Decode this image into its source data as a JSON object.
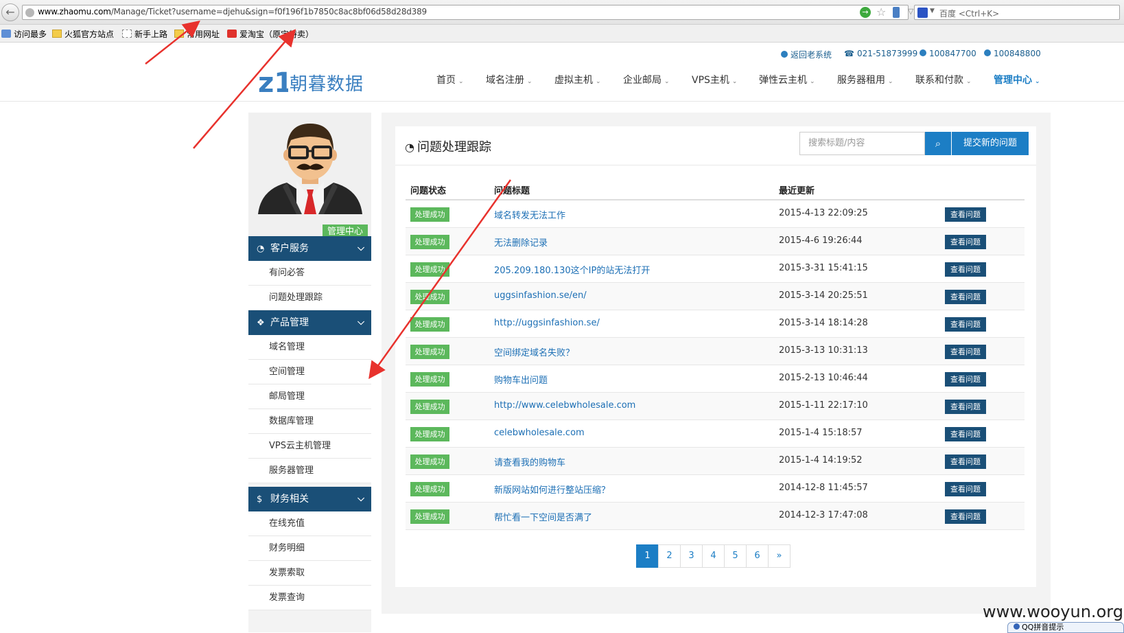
{
  "browser": {
    "url_host": "www.zhaomu.com",
    "url_path": "/Manage/Ticket?username=djehu&sign=f0f196f1b7850c8ac8bf06d58d28d389",
    "search_placeholder": "百度 <Ctrl+K>",
    "bookmarks": [
      "访问最多",
      "火狐官方站点",
      "新手上路",
      "常用网址",
      "爱淘宝（原",
      "宝特卖）"
    ]
  },
  "header": {
    "top_links": [
      "返回老系统",
      "021-51873999",
      "100847700",
      "100848800"
    ],
    "logo_text": "朝暮数据",
    "logo_mark": "z1",
    "nav": [
      "首页",
      "域名注册",
      "虚拟主机",
      "企业邮局",
      "VPS主机",
      "弹性云主机",
      "服务器租用",
      "联系和付款",
      "管理中心"
    ],
    "caret": "⌄"
  },
  "sidebar": {
    "badge": "管理中心",
    "sections": [
      {
        "title": "客户服务",
        "items": [
          "有问必答",
          "问题处理跟踪"
        ]
      },
      {
        "title": "产品管理",
        "items": [
          "域名管理",
          "空间管理",
          "邮局管理",
          "数据库管理",
          "VPS云主机管理",
          "服务器管理"
        ]
      },
      {
        "title": "财务相关",
        "items": [
          "在线充值",
          "财务明细",
          "发票索取",
          "发票查询"
        ]
      }
    ]
  },
  "main": {
    "title": "问题处理跟踪",
    "search_placeholder": "搜索标题/内容",
    "new_button": "提交新的问题",
    "columns": [
      "问题状态",
      "问题标题",
      "最近更新"
    ],
    "rows": [
      {
        "status": "处理成功",
        "title": "域名转发无法工作",
        "time": "2015-4-13 22:09:25",
        "action": "查看问题"
      },
      {
        "status": "处理成功",
        "title": "无法删除记录",
        "time": "2015-4-6 19:26:44",
        "action": "查看问题"
      },
      {
        "status": "处理成功",
        "title": "205.209.180.130这个IP的站无法打开",
        "time": "2015-3-31 15:41:15",
        "action": "查看问题"
      },
      {
        "status": "处理成功",
        "title": "uggsinfashion.se/en/",
        "time": "2015-3-14 20:25:51",
        "action": "查看问题"
      },
      {
        "status": "处理成功",
        "title": "http://uggsinfashion.se/",
        "time": "2015-3-14 18:14:28",
        "action": "查看问题"
      },
      {
        "status": "处理成功",
        "title": "空间绑定域名失败？",
        "time": "2015-3-13 10:31:13",
        "action": "查看问题"
      },
      {
        "status": "处理成功",
        "title": "购物车出问题",
        "time": "2015-2-13 10:46:44",
        "action": "查看问题"
      },
      {
        "status": "处理成功",
        "title": "http://www.celebwholesale.com",
        "time": "2015-1-11 22:17:10",
        "action": "查看问题"
      },
      {
        "status": "处理成功",
        "title": "celebwholesale.com",
        "time": "2015-1-4 15:18:57",
        "action": "查看问题"
      },
      {
        "status": "处理成功",
        "title": "请查看我的购物车",
        "time": "2015-1-4 14:19:52",
        "action": "查看问题"
      },
      {
        "status": "处理成功",
        "title": "新版网站如何进行整站压缩？",
        "time": "2014-12-8 11:45:57",
        "action": "查看问题"
      },
      {
        "status": "处理成功",
        "title": "帮忙看一下空间是否满了",
        "time": "2014-12-3 17:47:08",
        "action": "查看问题"
      }
    ],
    "pages": [
      "1",
      "2",
      "3",
      "4",
      "5",
      "6",
      "»"
    ],
    "active_page": "1"
  },
  "overlay": {
    "watermark": "www.wooyun.org",
    "popup_text": "QQ拼音提示"
  },
  "colors": {
    "brand_blue": "#1c7ec5",
    "sidebar_dark": "#1a4f77",
    "success_green": "#5cb85c",
    "annotation_red": "#e8322d"
  }
}
